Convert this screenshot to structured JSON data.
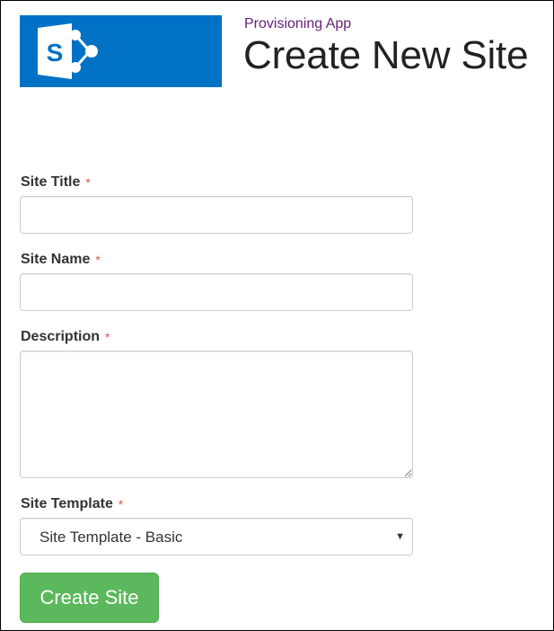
{
  "header": {
    "logo_icon": "sharepoint-logo",
    "logo_letter": "S",
    "logo_bg_color": "#0072c6",
    "app_name": "Provisioning App",
    "page_title": "Create New Site"
  },
  "form": {
    "required_marker": "*",
    "site_title": {
      "label": "Site Title",
      "value": "",
      "placeholder": ""
    },
    "site_name": {
      "label": "Site Name",
      "value": "",
      "placeholder": ""
    },
    "description": {
      "label": "Description",
      "value": "",
      "placeholder": ""
    },
    "site_template": {
      "label": "Site Template",
      "selected": "Site Template - Basic"
    },
    "submit_label": "Create Site",
    "submit_color": "#5cb85c"
  }
}
